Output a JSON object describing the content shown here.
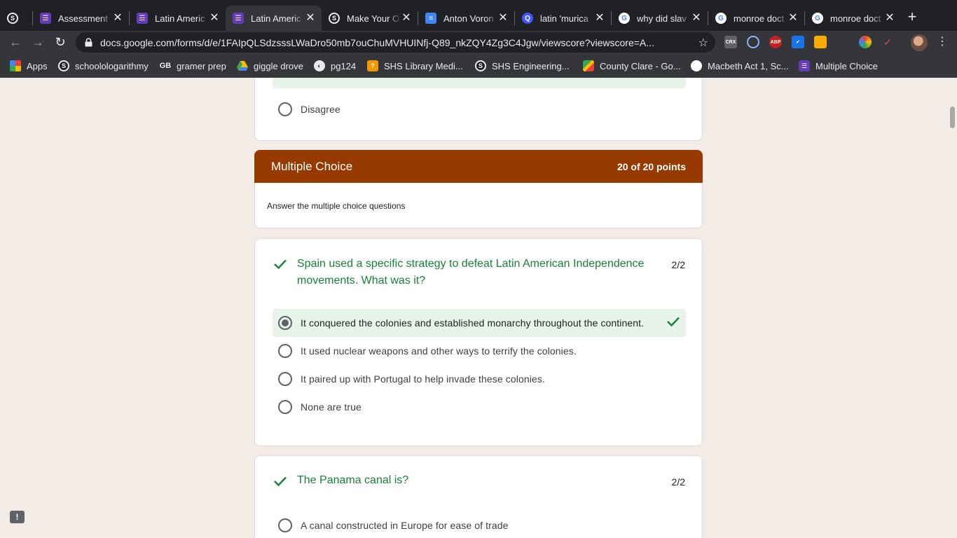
{
  "browser": {
    "tabs": [
      {
        "title": "",
        "icon": "schoology-icon"
      },
      {
        "title": "Assessment",
        "icon": "forms-icon"
      },
      {
        "title": "Latin Americ",
        "icon": "forms-icon"
      },
      {
        "title": "Latin Americ",
        "icon": "forms-icon"
      },
      {
        "title": "Make Your O",
        "icon": "schoology-icon"
      },
      {
        "title": "Anton Voron",
        "icon": "docs-icon"
      },
      {
        "title": "latin 'murica",
        "icon": "quizlet-icon"
      },
      {
        "title": "why did slav",
        "icon": "google-icon"
      },
      {
        "title": "monroe doct",
        "icon": "google-icon"
      },
      {
        "title": "monroe doct",
        "icon": "google-icon"
      }
    ],
    "new_tab": "+",
    "url": "docs.google.com/forms/d/e/1FAIpQLSdzsssLWaDro50mb7ouChuMVHUINfj-Q89_nkZQY4Zg3C4Jgw/viewscore?viewscore=A...",
    "extensions": [
      "CRX",
      "ABP"
    ],
    "bookmarks": [
      {
        "label": "Apps",
        "icon": "apps-grid-icon"
      },
      {
        "label": "schoolologarithmy",
        "icon": "schoology-icon"
      },
      {
        "label": "gramer prep",
        "icon": "gb-icon"
      },
      {
        "label": "giggle drove",
        "icon": "drive-icon"
      },
      {
        "label": "pg124",
        "icon": "globe-icon"
      },
      {
        "label": "SHS Library Medi...",
        "icon": "library-icon"
      },
      {
        "label": "SHS Engineering...",
        "icon": "schoology-icon"
      },
      {
        "label": "County Clare - Go...",
        "icon": "maps-icon"
      },
      {
        "label": "Macbeth Act 1, Sc...",
        "icon": "chart-icon"
      },
      {
        "label": "Multiple Choice",
        "icon": "forms-icon"
      }
    ]
  },
  "form": {
    "prev_option": "Disagree",
    "section": {
      "title": "Multiple Choice",
      "points": "20 of 20 points",
      "description": "Answer the multiple choice questions"
    },
    "questions": [
      {
        "title": "Spain used a specific strategy to defeat Latin American Independence movements. What was it?",
        "points": "2/2",
        "options": [
          "It conquered the colonies and established monarchy throughout the continent.",
          "It used nuclear weapons and other ways to terrify the colonies.",
          "It paired up with Portugal to help invade these colonies.",
          "None are true"
        ]
      },
      {
        "title": "The Panama canal is?",
        "points": "2/2",
        "options": [
          "A canal constructed in Europe for ease of trade"
        ]
      }
    ],
    "report_label": "!",
    "colors": {
      "section_header": "#963a00",
      "correct_green": "#188038",
      "correct_bg": "#e6f4ea",
      "page_bg": "#f3ebe6"
    }
  }
}
